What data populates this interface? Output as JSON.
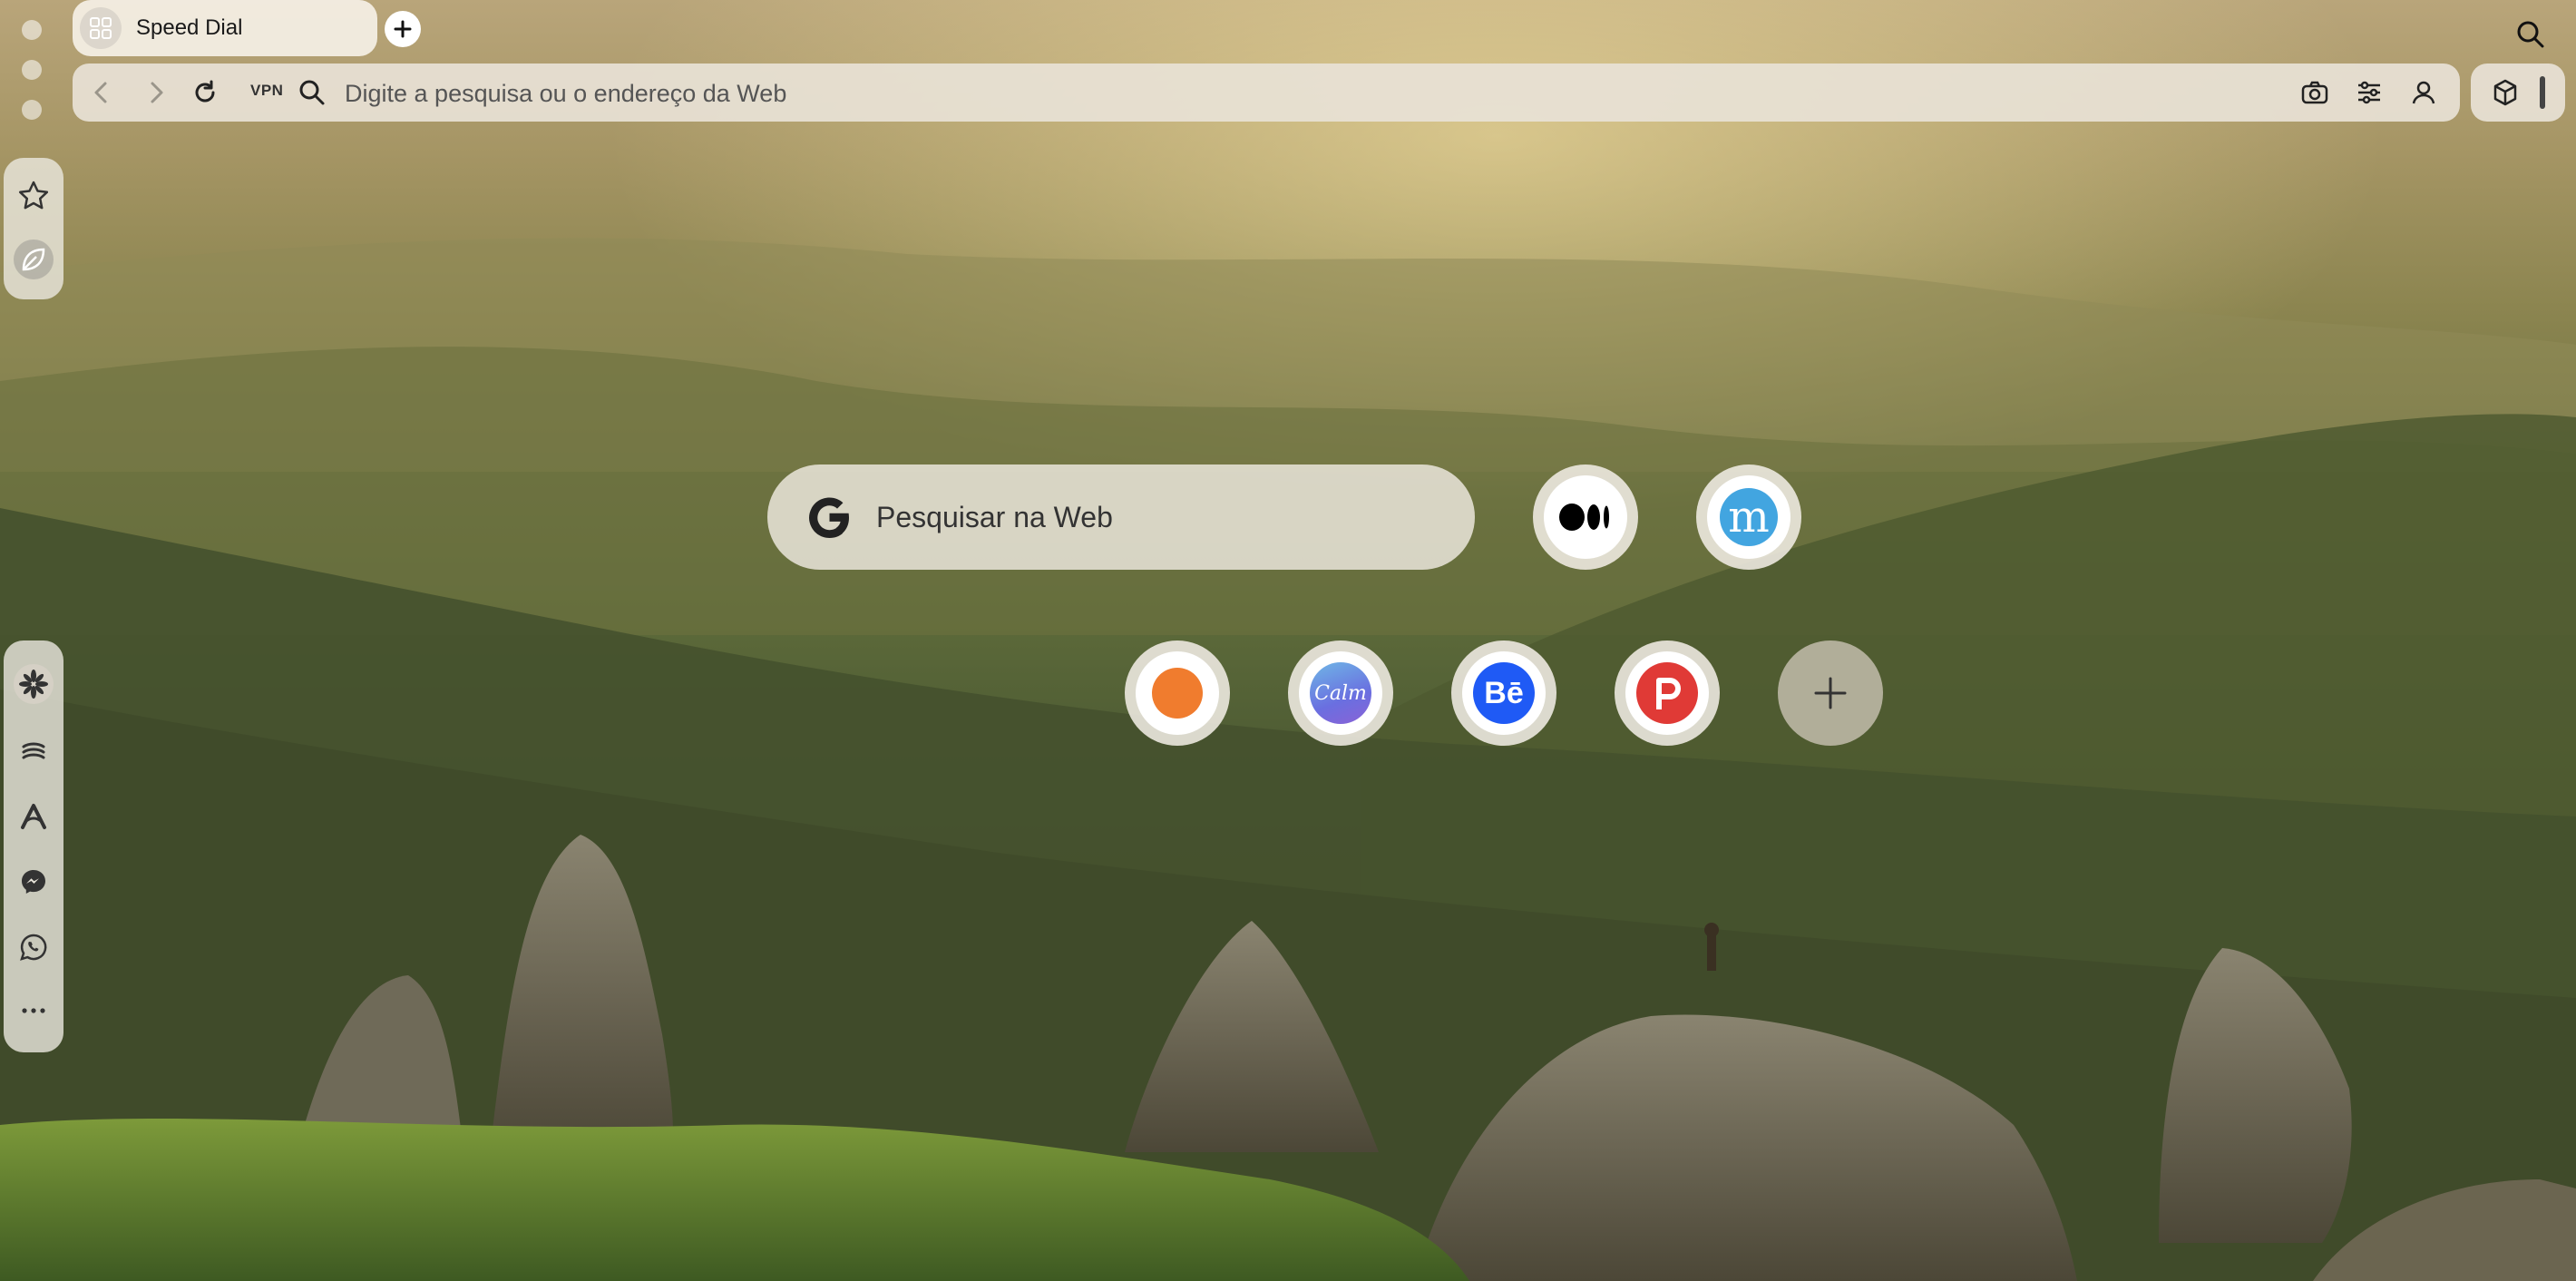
{
  "tabs": [
    {
      "title": "Speed Dial",
      "active": true
    }
  ],
  "address_bar": {
    "vpn_label": "VPN",
    "placeholder": "Digite a pesquisa ou o endereço da Web"
  },
  "search_widget": {
    "engine": "Google",
    "placeholder": "Pesquisar na Web"
  },
  "speed_dial": [
    {
      "name": "Medium",
      "icon": "medium-logo-icon",
      "bg": "#ffffff",
      "fg": "#000000"
    },
    {
      "name": "m",
      "icon": "m-logo-icon",
      "letter": "m",
      "bg": "#42a5e0",
      "fg": "#ffffff"
    },
    {
      "name": "Orange circle site",
      "icon": "orange-circle-icon",
      "bg": "#f07c2e"
    },
    {
      "name": "Calm",
      "icon": "calm-logo-icon",
      "letter": "Calm",
      "bg": "#6b8fe0",
      "fg": "#ffffff"
    },
    {
      "name": "Behance",
      "icon": "behance-logo-icon",
      "letter": "Bē",
      "bg": "#1f5af5",
      "fg": "#ffffff"
    },
    {
      "name": "Product Hunt",
      "icon": "product-hunt-logo-icon",
      "letter": "P",
      "bg": "#e03a36",
      "fg": "#ffffff"
    },
    {
      "name": "Add",
      "icon": "plus-icon"
    }
  ],
  "sidebar_top": [
    {
      "icon": "star-icon"
    },
    {
      "icon": "leaf-icon",
      "active": true
    }
  ],
  "sidebar_bottom": [
    {
      "icon": "aria-icon"
    },
    {
      "icon": "layers-icon"
    },
    {
      "icon": "arc-icon"
    },
    {
      "icon": "messenger-icon"
    },
    {
      "icon": "whatsapp-icon"
    },
    {
      "icon": "more-icon"
    }
  ]
}
